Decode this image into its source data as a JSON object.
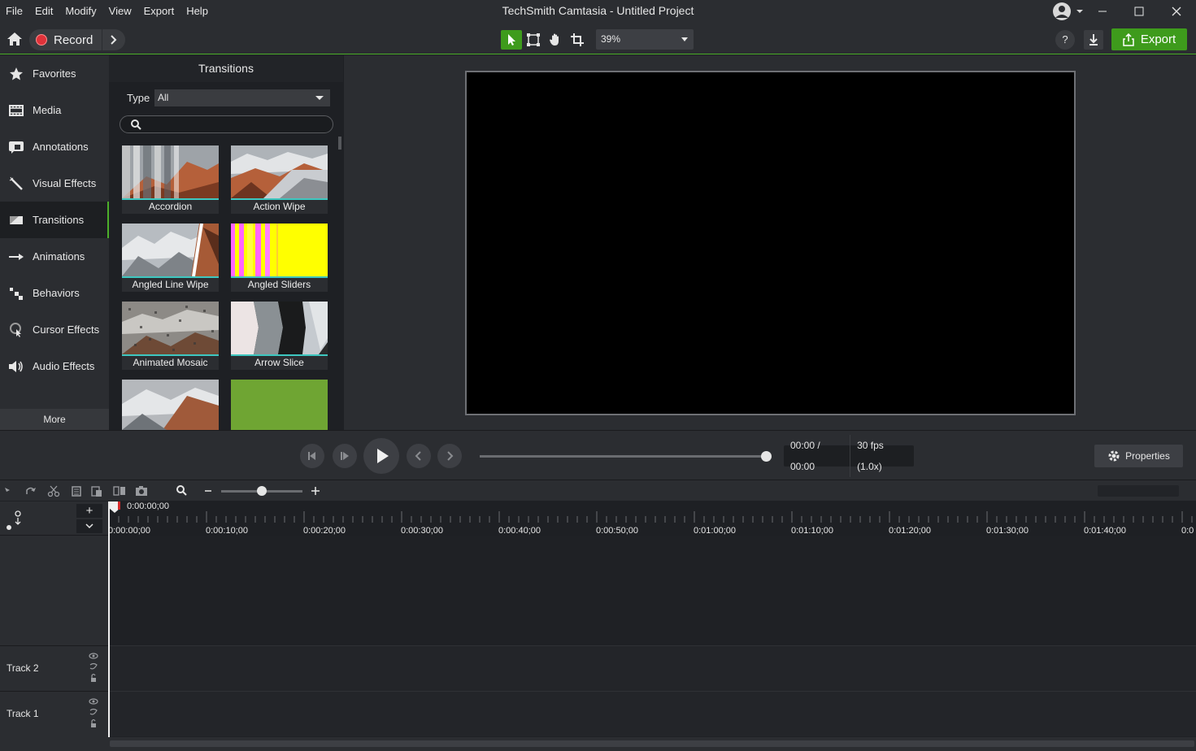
{
  "app": {
    "title": "TechSmith Camtasia - Untitled Project",
    "menu": [
      "File",
      "Edit",
      "Modify",
      "View",
      "Export",
      "Help"
    ]
  },
  "toolbar": {
    "record_label": "Record",
    "zoom_value": "39%",
    "help_label": "?",
    "export_label": "Export",
    "accent_color": "#3e9b1c"
  },
  "sidebar": {
    "items": [
      {
        "label": "Favorites",
        "icon": "star-icon"
      },
      {
        "label": "Media",
        "icon": "film-icon"
      },
      {
        "label": "Annotations",
        "icon": "annotation-icon"
      },
      {
        "label": "Visual Effects",
        "icon": "magic-wand-icon"
      },
      {
        "label": "Transitions",
        "icon": "transition-icon",
        "active": true
      },
      {
        "label": "Animations",
        "icon": "arrow-right-icon"
      },
      {
        "label": "Behaviors",
        "icon": "behaviors-icon"
      },
      {
        "label": "Cursor Effects",
        "icon": "cursor-icon"
      },
      {
        "label": "Audio Effects",
        "icon": "speaker-icon"
      }
    ],
    "more_label": "More"
  },
  "panel": {
    "title": "Transitions",
    "type_label": "Type",
    "type_value": "All",
    "search_placeholder": "",
    "thumbnails": [
      {
        "label": "Accordion"
      },
      {
        "label": "Action Wipe"
      },
      {
        "label": "Angled Line Wipe"
      },
      {
        "label": "Angled Sliders"
      },
      {
        "label": "Animated Mosaic"
      },
      {
        "label": "Arrow Slice"
      },
      {
        "label": ""
      },
      {
        "label": ""
      }
    ]
  },
  "playback": {
    "timecode": "00:00 / 00:00",
    "fps": "30 fps (1.0x)",
    "properties_label": "Properties",
    "progress": 1.0
  },
  "timeline": {
    "playhead_time": "0:00:00;00",
    "ruler_labels": [
      "0:00:00;00",
      "0:00:10;00",
      "0:00:20;00",
      "0:00:30;00",
      "0:00:40;00",
      "0:00:50;00",
      "0:01:00;00",
      "0:01:10;00",
      "0:01:20;00",
      "0:01:30;00",
      "0:01:40;00",
      "0:0"
    ],
    "add_label": "+",
    "tracks": [
      {
        "name": "Track 2"
      },
      {
        "name": "Track 1"
      }
    ]
  }
}
